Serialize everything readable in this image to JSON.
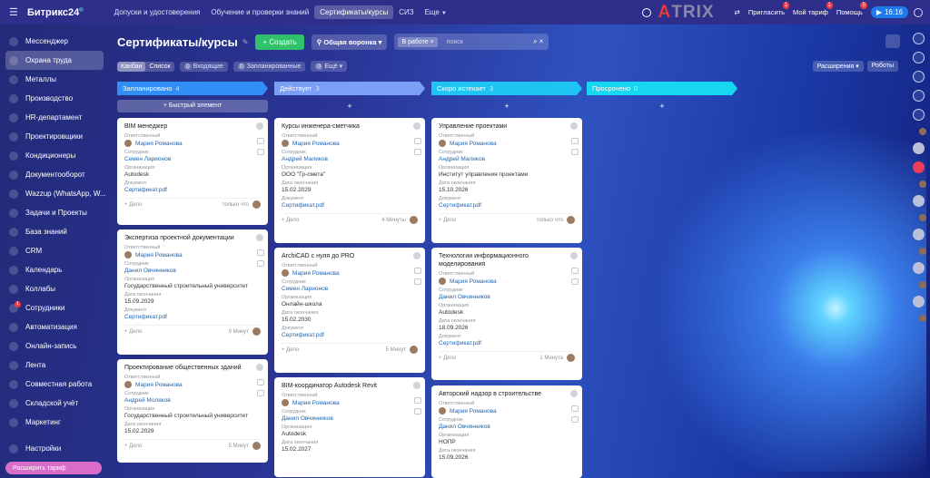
{
  "topbar": {
    "logo": "Битрикс24",
    "logo_badge": "©",
    "tabs": [
      {
        "label": "Допуски и удостоверения"
      },
      {
        "label": "Обучение и проверки знаний"
      },
      {
        "label": "Сертификаты/курсы"
      },
      {
        "label": "СИЗ"
      },
      {
        "label": "Еще"
      }
    ],
    "brand_left": "A",
    "brand_mid": "TRIX",
    "invite": "Пригласить",
    "invite_badge": "1",
    "tariff": "Мой тариф",
    "tariff_badge": "1",
    "help": "Помощь",
    "help_badge": "5",
    "time": "16:16"
  },
  "sidebar": {
    "items": [
      {
        "label": "Мессенджер",
        "icon": "chat-icon"
      },
      {
        "label": "Охрана труда",
        "icon": "shield-icon"
      },
      {
        "label": "Металлы",
        "icon": "metal-icon"
      },
      {
        "label": "Производство",
        "icon": "factory-icon"
      },
      {
        "label": "HR-департамент",
        "icon": "hr-icon"
      },
      {
        "label": "Проектировщики",
        "icon": "ruler-icon"
      },
      {
        "label": "Кондиционеры",
        "icon": "ac-icon"
      },
      {
        "label": "Документооборот",
        "icon": "doc-icon"
      },
      {
        "label": "Wazzup (WhatsApp, W...",
        "icon": "wazzup-icon"
      },
      {
        "label": "Задачи и Проекты",
        "icon": "tasks-icon"
      },
      {
        "label": "База знаний",
        "icon": "book-icon"
      },
      {
        "label": "CRM",
        "icon": "crm-icon"
      },
      {
        "label": "Календарь",
        "icon": "calendar-icon"
      },
      {
        "label": "Коллабы",
        "icon": "collab-icon"
      },
      {
        "label": "Сотрудники",
        "icon": "users-icon",
        "badge": "1"
      },
      {
        "label": "Автоматизация",
        "icon": "automation-icon"
      },
      {
        "label": "Онлайн-запись",
        "icon": "booking-icon"
      },
      {
        "label": "Лента",
        "icon": "feed-icon"
      },
      {
        "label": "Совместная работа",
        "icon": "cowork-icon"
      },
      {
        "label": "Складской учёт",
        "icon": "warehouse-icon"
      },
      {
        "label": "Маркетинг",
        "icon": "marketing-icon"
      }
    ],
    "settings": "Настройки",
    "upgrade": "Расширить тариф"
  },
  "header": {
    "title": "Сертификаты/курсы",
    "create": "+ Создать",
    "funnel": "Общая воронка",
    "filter_chip": "В работе",
    "search_placeholder": "поиск"
  },
  "subbar": {
    "kanban": "Канбан",
    "list": "Список",
    "incoming": "Входящие",
    "incoming_count": "0",
    "scheduled": "Запланированные",
    "scheduled_count": "0",
    "more": "Ещё",
    "more_count": "0",
    "extensions": "Расширения",
    "robots": "Роботы"
  },
  "columns": [
    {
      "title": "Запланировано",
      "count": "4",
      "color": "#2f8ff7",
      "add": "+ Быстрый элемент"
    },
    {
      "title": "Действует",
      "count": "3",
      "color": "#7a9ff4",
      "add": "+"
    },
    {
      "title": "Скоро истекает",
      "count": "3",
      "color": "#1ec4f2",
      "add": "+"
    },
    {
      "title": "Просрочено",
      "count": "0",
      "color": "#17d6f2",
      "add": "+"
    }
  ],
  "labels": {
    "resp": "Ответственный",
    "emp": "Сотрудник",
    "org": "Организация",
    "end": "Дата окончания",
    "doc": "Документ",
    "deal": "+ Дело"
  },
  "cards": [
    [
      {
        "title": "BIM менеджер",
        "resp": "Мария Романова",
        "emp": "Семен Ларионов",
        "org": "Autodesk",
        "end": "",
        "doc": "Сертификат.pdf",
        "time": "только что"
      },
      {
        "title": "Экспертиза проектной документации",
        "resp": "Мария Романова",
        "emp": "Данил Овчинников",
        "org": "Государственный строительный университет",
        "end": "15.09.2029",
        "doc": "Сертификат.pdf",
        "time": "9 Минут"
      },
      {
        "title": "Проектирование общественных зданий",
        "resp": "Мария Романова",
        "emp": "Андрей Моляков",
        "org": "Государственный строительный университет",
        "end": "15.02.2029",
        "doc": "",
        "time": "5 Минут"
      }
    ],
    [
      {
        "title": "Курсы инженера-сметчика",
        "resp": "Мария Романова",
        "emp": "Андрей Маликов",
        "org": "ООО \"Гр-смета\"",
        "end": "15.02.2029",
        "doc": "Сертификат.pdf",
        "time": "4 Минуты"
      },
      {
        "title": "ArchiCAD с нуля до PRO",
        "resp": "Мария Романова",
        "emp": "Семен Ларионов",
        "org": "Онлайн-школа",
        "end": "15.02.2030",
        "doc": "Сертификат.pdf",
        "time": "5 Минут"
      },
      {
        "title": "BIM-координатор Autodesk Revit",
        "resp": "Мария Романова",
        "emp": "Данил Овчинников",
        "org": "Autodesk",
        "end": "15.02.2027",
        "doc": "",
        "time": ""
      }
    ],
    [
      {
        "title": "Управление проектами",
        "resp": "Мария Романова",
        "emp": "Андрей Маликов",
        "org": "Институт управления проектами",
        "end": "15.10.2026",
        "doc": "Сертификат.pdf",
        "time": "только что"
      },
      {
        "title": "Технологии информационного моделирования",
        "resp": "Мария Романова",
        "emp": "Данил Овчинников",
        "org": "Autodesk",
        "end": "18.09.2026",
        "doc": "Сертификат.pdf",
        "time": "1 Минута"
      },
      {
        "title": "Авторский надзор в строительстве",
        "resp": "Мария Романова",
        "emp": "Данил Овчинников",
        "org": "НОПР",
        "end": "15.09.2026",
        "doc": "",
        "time": ""
      }
    ]
  ]
}
